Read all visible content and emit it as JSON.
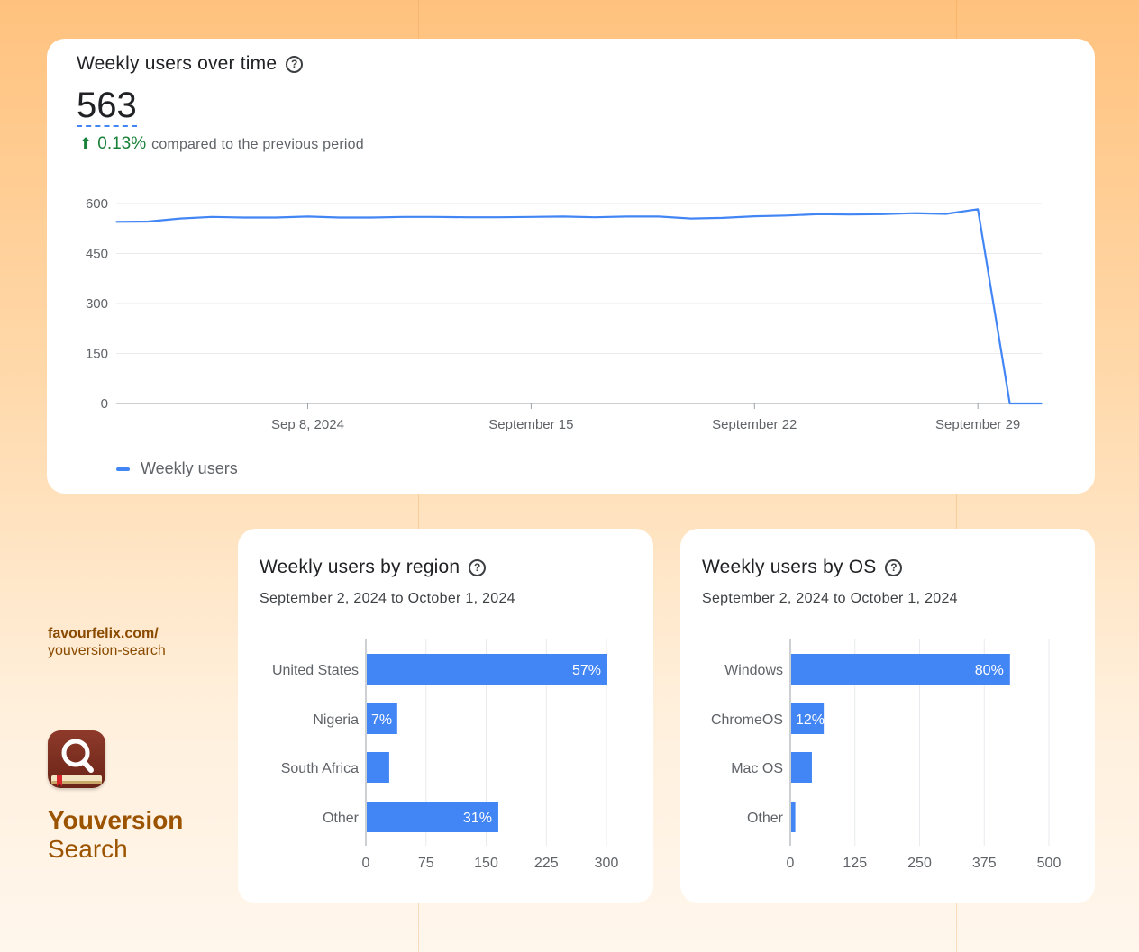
{
  "brand": {
    "url_line1": "favourfelix.com/",
    "url_line2": "youversion-search",
    "name_line1": "Youversion",
    "name_line2": "Search",
    "icon": "magnifier-book-icon"
  },
  "colors": {
    "accent": "#4285f4",
    "positive": "#188038",
    "brand": "#9c5300"
  },
  "card_time": {
    "title": "Weekly users over time",
    "value": "563",
    "delta_arrow": "⬆",
    "delta_value": "0.13%",
    "delta_text": "compared to the previous period",
    "legend_label": "Weekly users"
  },
  "card_region": {
    "title": "Weekly users by region",
    "subtitle": "September 2, 2024 to October 1, 2024"
  },
  "card_os": {
    "title": "Weekly users by OS",
    "subtitle": "September 2, 2024 to October 1, 2024"
  },
  "chart_data": [
    {
      "type": "line",
      "title": "Weekly users over time",
      "ylim": [
        0,
        600
      ],
      "yticks": [
        "0",
        "150",
        "300",
        "450",
        "600"
      ],
      "xtick_labels": [
        "Sep 8, 2024",
        "September 15",
        "September 22",
        "September 29"
      ],
      "x": [
        "Sep 2",
        "Sep 3",
        "Sep 4",
        "Sep 5",
        "Sep 6",
        "Sep 7",
        "Sep 8",
        "Sep 9",
        "Sep 10",
        "Sep 11",
        "Sep 12",
        "Sep 13",
        "Sep 14",
        "Sep 15",
        "Sep 16",
        "Sep 17",
        "Sep 18",
        "Sep 19",
        "Sep 20",
        "Sep 21",
        "Sep 22",
        "Sep 23",
        "Sep 24",
        "Sep 25",
        "Sep 26",
        "Sep 27",
        "Sep 28",
        "Sep 29",
        "Sep 30",
        "Oct 1"
      ],
      "series": [
        {
          "name": "Weekly users",
          "values": [
            545,
            546,
            555,
            560,
            558,
            558,
            561,
            558,
            558,
            560,
            560,
            559,
            559,
            560,
            561,
            559,
            561,
            561,
            555,
            557,
            562,
            564,
            568,
            567,
            568,
            571,
            569,
            583,
            0,
            0
          ]
        }
      ],
      "grid": true,
      "legend": "bottom-left"
    },
    {
      "type": "bar",
      "orientation": "horizontal",
      "title": "Weekly users by region",
      "categories": [
        "United States",
        "Nigeria",
        "South Africa",
        "Other"
      ],
      "values": [
        300,
        38,
        28,
        164
      ],
      "labels": [
        "57%",
        "7%",
        "",
        "31%"
      ],
      "xlim": [
        0,
        300
      ],
      "xticks": [
        "0",
        "75",
        "150",
        "225",
        "300"
      ],
      "grid": true
    },
    {
      "type": "bar",
      "orientation": "horizontal",
      "title": "Weekly users by OS",
      "categories": [
        "Windows",
        "ChromeOS",
        "Mac OS",
        "Other"
      ],
      "values": [
        423,
        63,
        40,
        8
      ],
      "labels": [
        "80%",
        "12%",
        "",
        ""
      ],
      "xlim": [
        0,
        500
      ],
      "xticks": [
        "0",
        "125",
        "250",
        "375",
        "500"
      ],
      "grid": true
    }
  ]
}
